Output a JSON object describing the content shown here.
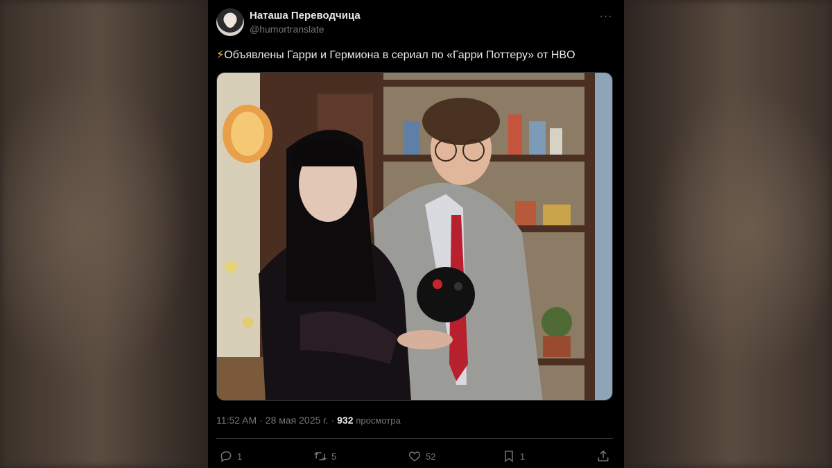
{
  "tweet": {
    "author_name": "Наташа Переводчица",
    "author_handle": "@humortranslate",
    "text_icon": "⚡",
    "text": "Объявлены Гарри и Гермиона в сериал по «Гарри Поттеру» от HBO",
    "time": "11:52 AM",
    "date": "28 мая 2025 г.",
    "views_count": "932",
    "views_label": "просмотра",
    "more_icon": "more-horizontal-icon"
  },
  "actions": {
    "replies": "1",
    "retweets": "5",
    "likes": "52",
    "bookmarks": "1"
  },
  "colors": {
    "background": "#000000",
    "text": "#e7e9ea",
    "secondary": "#71767b",
    "divider": "#2f3336"
  }
}
